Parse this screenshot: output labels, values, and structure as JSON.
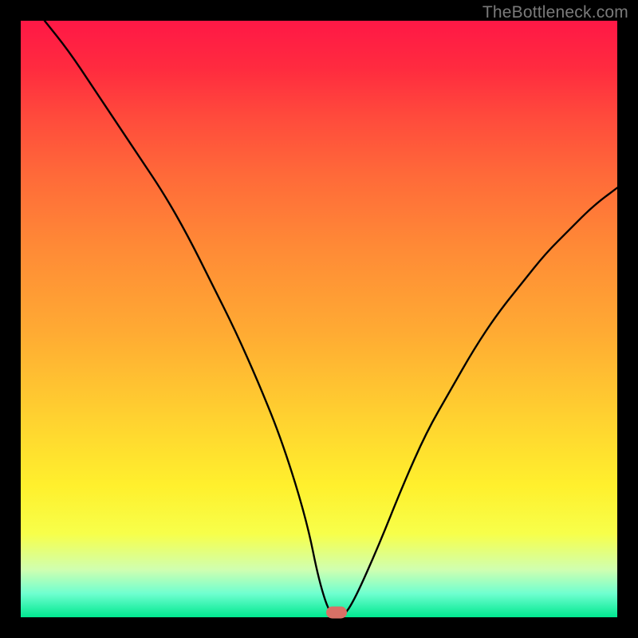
{
  "attribution": "TheBottleneck.com",
  "colors": {
    "frame": "#000000",
    "gradient_top": "#ff1846",
    "gradient_bottom": "#00e890",
    "curve": "#000000",
    "marker": "#d97066",
    "attribution_text": "#7a7a7a"
  },
  "chart_data": {
    "type": "line",
    "title": "",
    "xlabel": "",
    "ylabel": "",
    "xlim": [
      0,
      100
    ],
    "ylim": [
      0,
      100
    ],
    "x": [
      4,
      8,
      12,
      16,
      20,
      24,
      28,
      32,
      36,
      40,
      44,
      48,
      50,
      52,
      54,
      56,
      60,
      64,
      68,
      72,
      76,
      80,
      84,
      88,
      92,
      96,
      100
    ],
    "values": [
      100,
      95,
      89,
      83,
      77,
      71,
      64,
      56,
      48,
      39,
      29,
      16,
      6,
      0,
      0,
      3,
      12,
      22,
      31,
      38,
      45,
      51,
      56,
      61,
      65,
      69,
      72
    ],
    "marker": {
      "x": 53,
      "y": 0
    },
    "notes": "Axis units are percentages of the plot area; no numeric tick labels are shown in the figure."
  }
}
